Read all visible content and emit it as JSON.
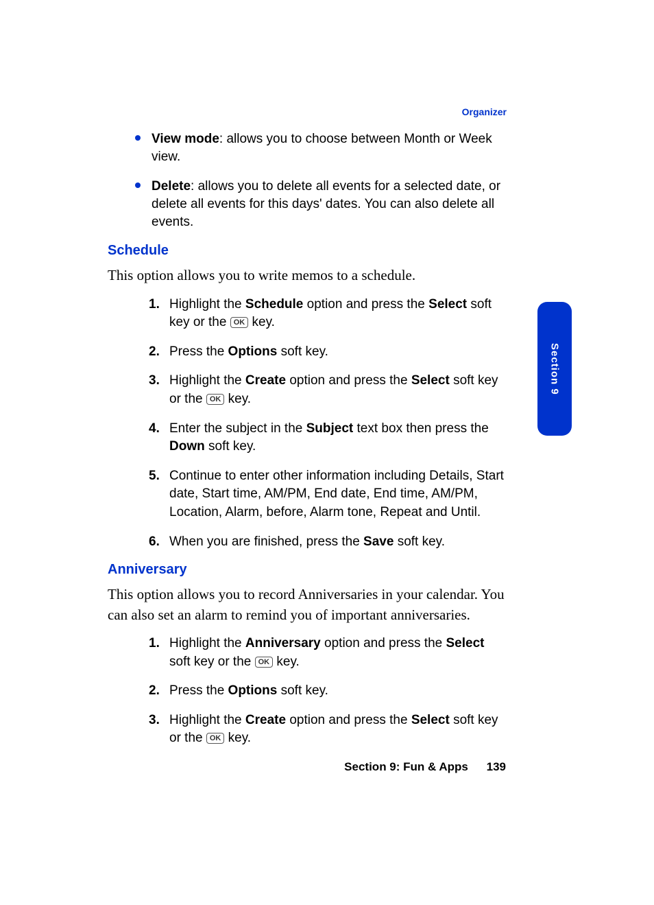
{
  "header": "Organizer",
  "bullets": [
    {
      "title": "View mode",
      "text": ": allows you to choose between Month or Week view."
    },
    {
      "title": "Delete",
      "text": ": allows you to delete all events for a selected date, or delete all events for this days' dates. You can also delete all events."
    }
  ],
  "schedule": {
    "heading": "Schedule",
    "intro": "This option allows you to write memos to a schedule.",
    "steps": {
      "s1_a": "Highlight the ",
      "s1_b": "Schedule",
      "s1_c": " option and press the ",
      "s1_d": "Select",
      "s1_e": " soft key or the ",
      "s1_f": " key.",
      "s2_a": "Press the ",
      "s2_b": "Options",
      "s2_c": " soft key.",
      "s3_a": "Highlight the ",
      "s3_b": "Create",
      "s3_c": " option and press the ",
      "s3_d": "Select",
      "s3_e": " soft key or the ",
      "s3_f": " key.",
      "s4_a": "Enter the subject in the ",
      "s4_b": "Subject",
      "s4_c": " text box then press the ",
      "s4_d": "Down",
      "s4_e": " soft key.",
      "s5": "Continue to enter other information including Details, Start date, Start time, AM/PM, End date, End time, AM/PM, Location, Alarm, before, Alarm tone, Repeat and Until.",
      "s6_a": "When you are finished, press the ",
      "s6_b": "Save",
      "s6_c": " soft key."
    }
  },
  "anniversary": {
    "heading": "Anniversary",
    "intro": "This option allows you to record Anniversaries in your calendar. You can also set an alarm to remind you of important anniversaries.",
    "steps": {
      "s1_a": "Highlight the ",
      "s1_b": "Anniversary",
      "s1_c": " option and press the ",
      "s1_d": "Select",
      "s1_e": " soft key or the ",
      "s1_f": " key.",
      "s2_a": "Press the ",
      "s2_b": "Options",
      "s2_c": " soft key.",
      "s3_a": "Highlight the ",
      "s3_b": "Create",
      "s3_c": " option and press the ",
      "s3_d": "Select",
      "s3_e": " soft key or the ",
      "s3_f": " key."
    }
  },
  "ok_label": "OK",
  "side_tab": "Section 9",
  "footer_section": "Section 9: Fun & Apps",
  "footer_page": "139",
  "nums": {
    "n1": "1.",
    "n2": "2.",
    "n3": "3.",
    "n4": "4.",
    "n5": "5.",
    "n6": "6."
  }
}
